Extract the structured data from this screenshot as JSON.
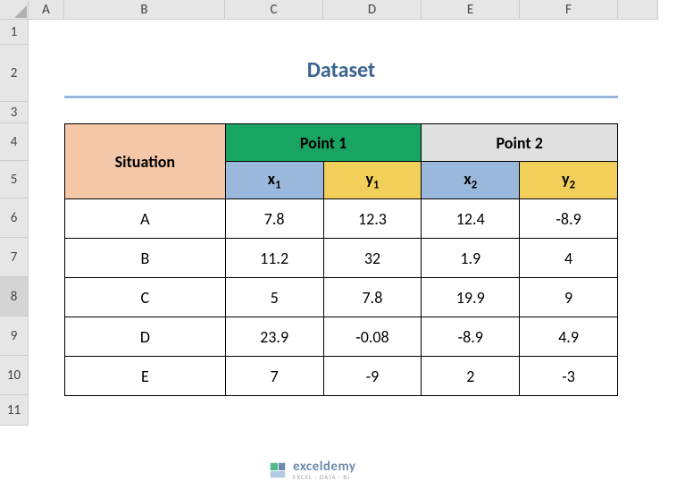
{
  "columns": [
    "A",
    "B",
    "C",
    "D",
    "E",
    "F"
  ],
  "rows": [
    "1",
    "2",
    "3",
    "4",
    "5",
    "6",
    "7",
    "8",
    "9",
    "10",
    "11"
  ],
  "selectedRow": "8",
  "title": "Dataset",
  "headers": {
    "situation": "Situation",
    "point1": "Point 1",
    "point2": "Point 2",
    "x1": "x",
    "x1_sub": "1",
    "y1": "y",
    "y1_sub": "1",
    "x2": "x",
    "x2_sub": "2",
    "y2": "y",
    "y2_sub": "2"
  },
  "data": [
    {
      "situation": "A",
      "x1": "7.8",
      "y1": "12.3",
      "x2": "12.4",
      "y2": "-8.9"
    },
    {
      "situation": "B",
      "x1": "11.2",
      "y1": "32",
      "x2": "1.9",
      "y2": "4"
    },
    {
      "situation": "C",
      "x1": "5",
      "y1": "7.8",
      "x2": "19.9",
      "y2": "9"
    },
    {
      "situation": "D",
      "x1": "23.9",
      "y1": "-0.08",
      "x2": "-8.9",
      "y2": "4.9"
    },
    {
      "situation": "E",
      "x1": "7",
      "y1": "-9",
      "x2": "2",
      "y2": "-3"
    }
  ],
  "watermark": {
    "brand": "exceldemy",
    "tag": "EXCEL · DATA · BI"
  }
}
